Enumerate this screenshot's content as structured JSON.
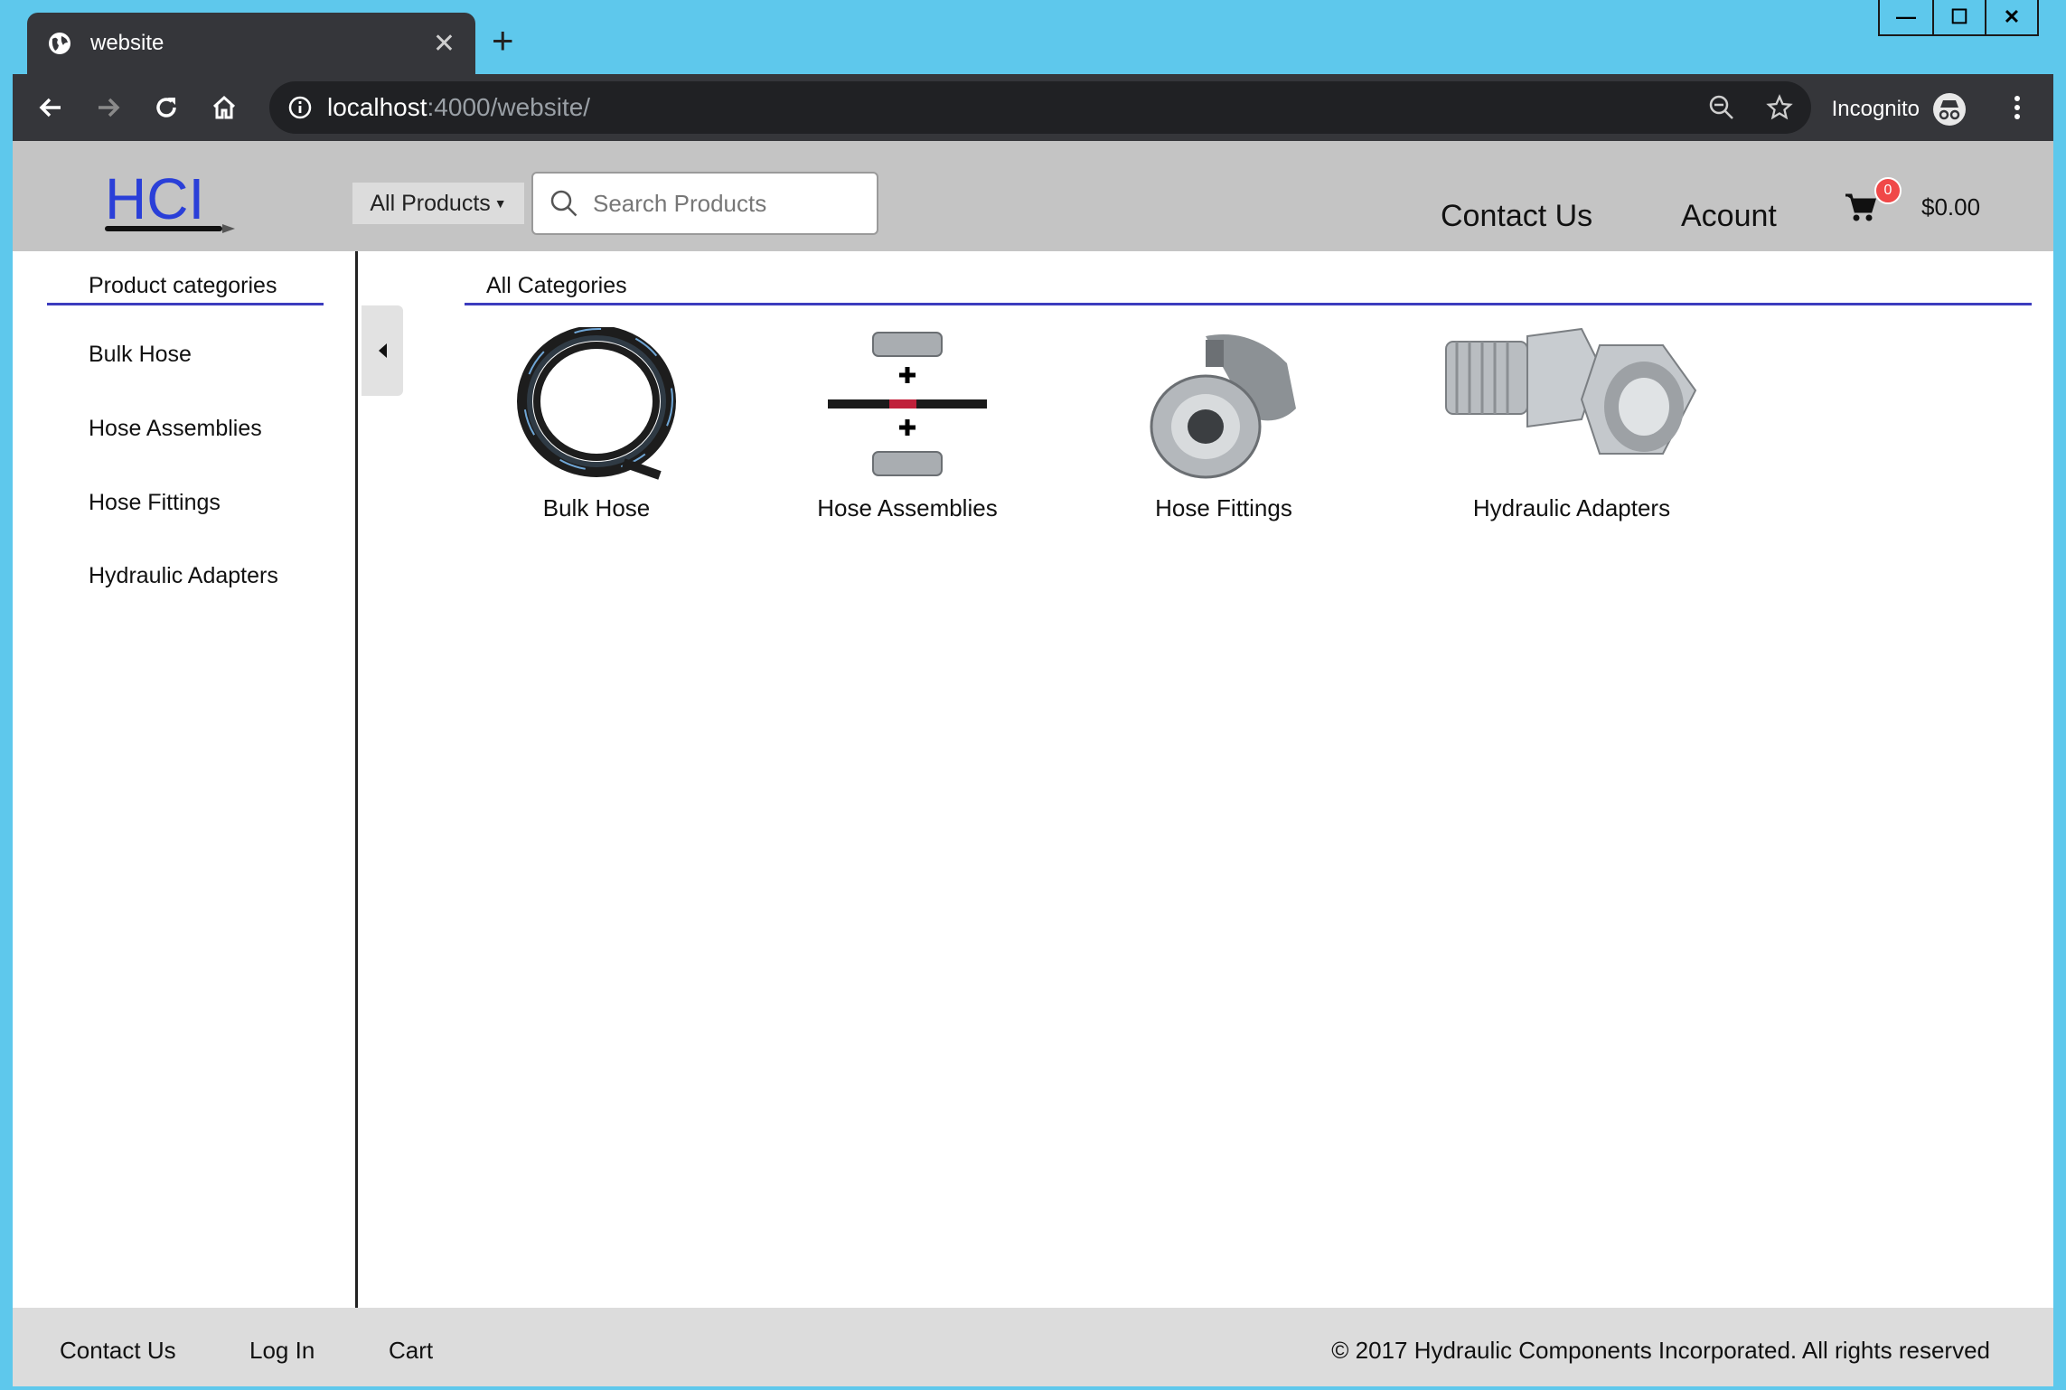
{
  "browser": {
    "tab_title": "website",
    "url_host": "localhost",
    "url_rest": ":4000/website/",
    "incognito_label": "Incognito"
  },
  "header": {
    "logo_text": "HCI",
    "category_select": "All Products",
    "search_placeholder": "Search Products",
    "nav": [
      "Contact Us",
      "Acount"
    ],
    "cart_count": "0",
    "cart_total": "$0.00"
  },
  "sidebar": {
    "title": "Product categories",
    "items": [
      "Bulk Hose",
      "Hose Assemblies",
      "Hose Fittings",
      "Hydraulic Adapters"
    ]
  },
  "main": {
    "title": "All Categories",
    "categories": [
      "Bulk Hose",
      "Hose Assemblies",
      "Hose Fittings",
      "Hydraulic Adapters"
    ]
  },
  "footer": {
    "links": [
      "Contact Us",
      "Log In",
      "Cart"
    ],
    "copyright": "© 2017 Hydraulic Components Incorporated. All rights reserved"
  },
  "colors": {
    "accent_rule": "#3c3cbe",
    "header_bg": "#c4c4c4",
    "badge": "#f04848",
    "frame": "#5ec8ec"
  }
}
